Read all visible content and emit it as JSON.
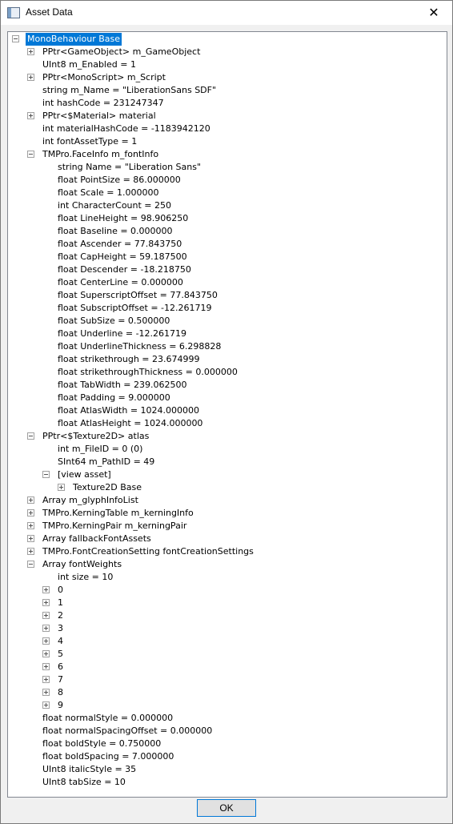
{
  "window": {
    "title": "Asset Data",
    "close_glyph": "✕",
    "ok_label": "OK"
  },
  "tree": [
    {
      "label": "MonoBehaviour Base",
      "level": 0,
      "toggle": "minus",
      "selected": true
    },
    {
      "label": "PPtr<GameObject> m_GameObject",
      "level": 1,
      "toggle": "plus"
    },
    {
      "label": "UInt8 m_Enabled = 1",
      "level": 1
    },
    {
      "label": "PPtr<MonoScript> m_Script",
      "level": 1,
      "toggle": "plus"
    },
    {
      "label": "string m_Name = \"LiberationSans SDF\"",
      "level": 1
    },
    {
      "label": "int hashCode = 231247347",
      "level": 1
    },
    {
      "label": "PPtr<$Material> material",
      "level": 1,
      "toggle": "plus"
    },
    {
      "label": "int materialHashCode = -1183942120",
      "level": 1
    },
    {
      "label": "int fontAssetType = 1",
      "level": 1
    },
    {
      "label": "TMPro.FaceInfo m_fontInfo",
      "level": 1,
      "toggle": "minus"
    },
    {
      "label": "string Name = \"Liberation Sans\"",
      "level": 2
    },
    {
      "label": "float PointSize = 86.000000",
      "level": 2
    },
    {
      "label": "float Scale = 1.000000",
      "level": 2
    },
    {
      "label": "int CharacterCount = 250",
      "level": 2
    },
    {
      "label": "float LineHeight = 98.906250",
      "level": 2
    },
    {
      "label": "float Baseline = 0.000000",
      "level": 2
    },
    {
      "label": "float Ascender = 77.843750",
      "level": 2
    },
    {
      "label": "float CapHeight = 59.187500",
      "level": 2
    },
    {
      "label": "float Descender = -18.218750",
      "level": 2
    },
    {
      "label": "float CenterLine = 0.000000",
      "level": 2
    },
    {
      "label": "float SuperscriptOffset = 77.843750",
      "level": 2
    },
    {
      "label": "float SubscriptOffset = -12.261719",
      "level": 2
    },
    {
      "label": "float SubSize = 0.500000",
      "level": 2
    },
    {
      "label": "float Underline = -12.261719",
      "level": 2
    },
    {
      "label": "float UnderlineThickness = 6.298828",
      "level": 2
    },
    {
      "label": "float strikethrough = 23.674999",
      "level": 2
    },
    {
      "label": "float strikethroughThickness = 0.000000",
      "level": 2
    },
    {
      "label": "float TabWidth = 239.062500",
      "level": 2
    },
    {
      "label": "float Padding = 9.000000",
      "level": 2
    },
    {
      "label": "float AtlasWidth = 1024.000000",
      "level": 2
    },
    {
      "label": "float AtlasHeight = 1024.000000",
      "level": 2
    },
    {
      "label": "PPtr<$Texture2D> atlas",
      "level": 1,
      "toggle": "minus"
    },
    {
      "label": "int m_FileID = 0 (0)",
      "level": 2
    },
    {
      "label": "SInt64 m_PathID = 49",
      "level": 2
    },
    {
      "label": "[view asset]",
      "level": 2,
      "toggle": "minus"
    },
    {
      "label": "Texture2D Base",
      "level": 3,
      "toggle": "plus"
    },
    {
      "label": "Array m_glyphInfoList",
      "level": 1,
      "toggle": "plus"
    },
    {
      "label": "TMPro.KerningTable m_kerningInfo",
      "level": 1,
      "toggle": "plus"
    },
    {
      "label": "TMPro.KerningPair m_kerningPair",
      "level": 1,
      "toggle": "plus"
    },
    {
      "label": "Array fallbackFontAssets",
      "level": 1,
      "toggle": "plus"
    },
    {
      "label": "TMPro.FontCreationSetting fontCreationSettings",
      "level": 1,
      "toggle": "plus"
    },
    {
      "label": "Array fontWeights",
      "level": 1,
      "toggle": "minus"
    },
    {
      "label": "int size = 10",
      "level": 2
    },
    {
      "label": "0",
      "level": 2,
      "toggle": "plus"
    },
    {
      "label": "1",
      "level": 2,
      "toggle": "plus"
    },
    {
      "label": "2",
      "level": 2,
      "toggle": "plus"
    },
    {
      "label": "3",
      "level": 2,
      "toggle": "plus"
    },
    {
      "label": "4",
      "level": 2,
      "toggle": "plus"
    },
    {
      "label": "5",
      "level": 2,
      "toggle": "plus"
    },
    {
      "label": "6",
      "level": 2,
      "toggle": "plus"
    },
    {
      "label": "7",
      "level": 2,
      "toggle": "plus"
    },
    {
      "label": "8",
      "level": 2,
      "toggle": "plus"
    },
    {
      "label": "9",
      "level": 2,
      "toggle": "plus"
    },
    {
      "label": "float normalStyle = 0.000000",
      "level": 1
    },
    {
      "label": "float normalSpacingOffset = 0.000000",
      "level": 1
    },
    {
      "label": "float boldStyle = 0.750000",
      "level": 1
    },
    {
      "label": "float boldSpacing = 7.000000",
      "level": 1
    },
    {
      "label": "UInt8 italicStyle = 35",
      "level": 1
    },
    {
      "label": "UInt8 tabSize = 10",
      "level": 1
    }
  ]
}
